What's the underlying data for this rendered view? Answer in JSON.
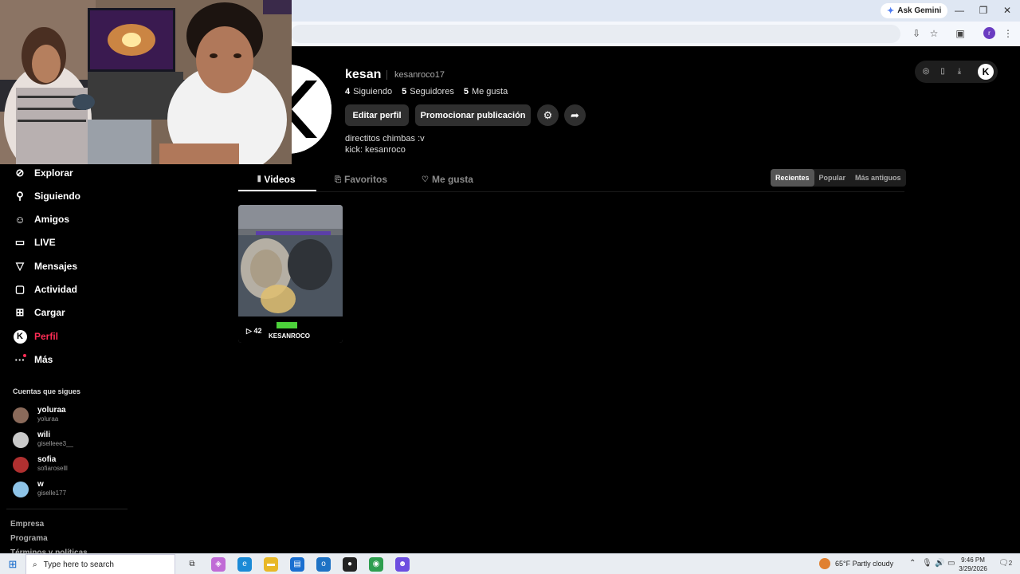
{
  "browser": {
    "gemini_label": "Ask Gemini",
    "profile_initial": "r"
  },
  "sidebar": {
    "items": [
      {
        "label": "Explorar",
        "icon": "compass-icon"
      },
      {
        "label": "Siguiendo",
        "icon": "user-follow-icon"
      },
      {
        "label": "Amigos",
        "icon": "friends-icon"
      },
      {
        "label": "LIVE",
        "icon": "live-tv-icon"
      },
      {
        "label": "Mensajes",
        "icon": "send-icon"
      },
      {
        "label": "Actividad",
        "icon": "activity-icon"
      },
      {
        "label": "Cargar",
        "icon": "upload-plus-icon"
      },
      {
        "label": "Perfil",
        "icon": "profile-k-icon"
      },
      {
        "label": "Más",
        "icon": "more-dots-icon"
      }
    ],
    "following_title": "Cuentas que sigues",
    "accounts": [
      {
        "name": "yoluraa",
        "user": "yoluraa"
      },
      {
        "name": "wili",
        "user": "giselleee3__"
      },
      {
        "name": "sofia",
        "user": "sofiaroselll"
      },
      {
        "name": "w",
        "user": "giselle177"
      }
    ],
    "footer": [
      "Empresa",
      "Programa",
      "Términos y políticas"
    ]
  },
  "profile": {
    "name": "kesan",
    "handle": "kesanroco17",
    "following_count": "4",
    "following_label": "Siguiendo",
    "followers_count": "5",
    "followers_label": "Seguidores",
    "likes_count": "5",
    "likes_label": "Me gusta",
    "edit_button": "Editar perfil",
    "promote_button": "Promocionar publicación",
    "bio_line1": "directitos chimbas :v",
    "bio_line2": "kick: kesanroco",
    "avatar_letter": "K"
  },
  "tabs": [
    {
      "label": "Videos",
      "icon": "grid-icon"
    },
    {
      "label": "Favoritos",
      "icon": "bookmark-icon"
    },
    {
      "label": "Me gusta",
      "icon": "heart-icon"
    }
  ],
  "sort_options": [
    "Recientes",
    "Popular",
    "Más antiguos"
  ],
  "videos": [
    {
      "views": "42",
      "overlay_text": "KESANROCO"
    }
  ],
  "taskbar": {
    "search_placeholder": "Type here to search",
    "weather": "65°F  Partly cloudy",
    "time": "9:46 PM",
    "date": "3/29/2026",
    "notification_count": "2"
  },
  "colors": {
    "accent": "#fe2c55",
    "background": "#000000",
    "button": "#2f2f2f"
  }
}
